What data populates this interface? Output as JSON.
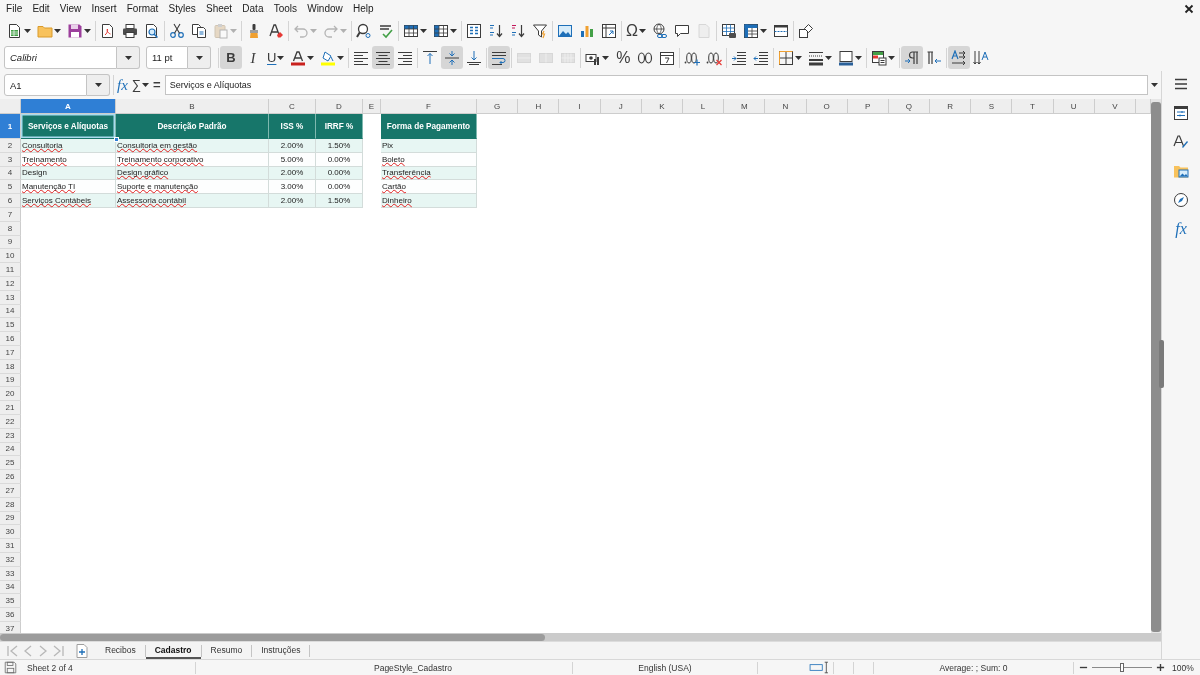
{
  "menu_bar": [
    "File",
    "Edit",
    "View",
    "Insert",
    "Format",
    "Styles",
    "Sheet",
    "Data",
    "Tools",
    "Window",
    "Help"
  ],
  "standard_toolbar": {
    "paste_disabled": true,
    "undo_disabled": true,
    "redo_disabled": true,
    "special_character": "Ω",
    "headers_footers_disabled": true
  },
  "formatting_toolbar": {
    "font_name": "Calibri",
    "font_size": "11 pt",
    "bold": {
      "label": "B",
      "on": true
    },
    "italic": {
      "label": "I",
      "on": false
    },
    "underline": {
      "label": "U",
      "on": false
    },
    "align_left": false,
    "align_center": true,
    "align_right": false,
    "align_top": false,
    "align_middle": true,
    "align_bottom": false,
    "wrap_text": true,
    "merge_disabled": true,
    "percent_format": "%",
    "left_to_right": true,
    "right_to_left": false,
    "text_horizontal": true,
    "text_vertical": false
  },
  "formula_bar": {
    "cell_reference": "A1",
    "function_wizard": "fx",
    "sum": "∑",
    "formula": "=",
    "content": "Serviços e Alíquotas"
  },
  "column_headers": [
    {
      "label": "A",
      "selected": true
    },
    {
      "label": "B",
      "selected": false
    },
    {
      "label": "C",
      "selected": false
    },
    {
      "label": "D",
      "selected": false
    },
    {
      "label": "E",
      "selected": false
    },
    {
      "label": "F",
      "selected": false
    },
    {
      "label": "G",
      "selected": false
    },
    {
      "label": "H",
      "selected": false
    },
    {
      "label": "I",
      "selected": false
    },
    {
      "label": "J",
      "selected": false
    },
    {
      "label": "K",
      "selected": false
    },
    {
      "label": "L",
      "selected": false
    },
    {
      "label": "M",
      "selected": false
    },
    {
      "label": "N",
      "selected": false
    },
    {
      "label": "O",
      "selected": false
    },
    {
      "label": "P",
      "selected": false
    },
    {
      "label": "Q",
      "selected": false
    },
    {
      "label": "R",
      "selected": false
    },
    {
      "label": "S",
      "selected": false
    },
    {
      "label": "T",
      "selected": false
    },
    {
      "label": "U",
      "selected": false
    },
    {
      "label": "V",
      "selected": false
    }
  ],
  "row_headers": [
    {
      "label": "1",
      "selected": true
    },
    {
      "label": "2",
      "selected": false
    },
    {
      "label": "3",
      "selected": false
    },
    {
      "label": "4",
      "selected": false
    },
    {
      "label": "5",
      "selected": false
    },
    {
      "label": "6",
      "selected": false
    },
    {
      "label": "7",
      "selected": false
    },
    {
      "label": "8",
      "selected": false
    },
    {
      "label": "9",
      "selected": false
    },
    {
      "label": "10",
      "selected": false
    },
    {
      "label": "11",
      "selected": false
    },
    {
      "label": "12",
      "selected": false
    },
    {
      "label": "13",
      "selected": false
    },
    {
      "label": "14",
      "selected": false
    },
    {
      "label": "15",
      "selected": false
    },
    {
      "label": "16",
      "selected": false
    },
    {
      "label": "17",
      "selected": false
    },
    {
      "label": "18",
      "selected": false
    },
    {
      "label": "19",
      "selected": false
    },
    {
      "label": "20",
      "selected": false
    },
    {
      "label": "21",
      "selected": false
    },
    {
      "label": "22",
      "selected": false
    },
    {
      "label": "23",
      "selected": false
    },
    {
      "label": "24",
      "selected": false
    },
    {
      "label": "25",
      "selected": false
    },
    {
      "label": "26",
      "selected": false
    },
    {
      "label": "27",
      "selected": false
    },
    {
      "label": "28",
      "selected": false
    },
    {
      "label": "29",
      "selected": false
    },
    {
      "label": "30",
      "selected": false
    },
    {
      "label": "31",
      "selected": false
    },
    {
      "label": "32",
      "selected": false
    },
    {
      "label": "33",
      "selected": false
    },
    {
      "label": "34",
      "selected": false
    },
    {
      "label": "35",
      "selected": false
    },
    {
      "label": "36",
      "selected": false
    },
    {
      "label": "37",
      "selected": false
    }
  ],
  "services_table": {
    "header": [
      {
        "text": "Serviços e Alíquotas",
        "selected": true
      },
      {
        "text": "Descrição Padrão",
        "selected": false
      },
      {
        "text": "ISS %",
        "selected": false
      },
      {
        "text": "IRRF %",
        "selected": false
      }
    ],
    "rows": [
      [
        {
          "text": "Consultoria",
          "selected": false,
          "spell_error": true
        },
        {
          "text": "Consultoria em gestão",
          "selected": false,
          "spell_error": true
        },
        {
          "text": "2.00%",
          "selected": false,
          "spell_error": false
        },
        {
          "text": "1.50%",
          "selected": false,
          "spell_error": false
        }
      ],
      [
        {
          "text": "Treinamento",
          "selected": false,
          "spell_error": true
        },
        {
          "text": "Treinamento corporativo",
          "selected": false,
          "spell_error": true
        },
        {
          "text": "5.00%",
          "selected": false,
          "spell_error": false
        },
        {
          "text": "0.00%",
          "selected": false,
          "spell_error": false
        }
      ],
      [
        {
          "text": "Design",
          "selected": false,
          "spell_error": false
        },
        {
          "text": "Design gráfico",
          "selected": false,
          "spell_error": true
        },
        {
          "text": "2.00%",
          "selected": false,
          "spell_error": false
        },
        {
          "text": "0.00%",
          "selected": false,
          "spell_error": false
        }
      ],
      [
        {
          "text": "Manutenção TI",
          "selected": false,
          "spell_error": true
        },
        {
          "text": "Suporte e manutenção",
          "selected": false,
          "spell_error": true
        },
        {
          "text": "3.00%",
          "selected": false,
          "spell_error": false
        },
        {
          "text": "0.00%",
          "selected": false,
          "spell_error": false
        }
      ],
      [
        {
          "text": "Serviços Contábeis",
          "selected": false,
          "spell_error": true
        },
        {
          "text": "Assessoria contábil",
          "selected": false,
          "spell_error": true
        },
        {
          "text": "2.00%",
          "selected": false,
          "spell_error": false
        },
        {
          "text": "1.50%",
          "selected": false,
          "spell_error": false
        }
      ]
    ]
  },
  "payment_table": {
    "header": {
      "text": "Forma de Pagamento",
      "selected": false
    },
    "rows": [
      {
        "text": "Pix",
        "selected": false,
        "spell_error": false
      },
      {
        "text": "Boleto",
        "selected": false,
        "spell_error": true
      },
      {
        "text": "Transferência",
        "selected": false,
        "spell_error": true
      },
      {
        "text": "Cartão",
        "selected": false,
        "spell_error": true
      },
      {
        "text": "Dinheiro",
        "selected": false,
        "spell_error": true
      }
    ]
  },
  "sheet_navigation": {
    "disabled": true
  },
  "sheet_tabs": [
    {
      "label": "Recibos",
      "selected": false
    },
    {
      "label": "Cadastro",
      "selected": true
    },
    {
      "label": "Resumo",
      "selected": false
    },
    {
      "label": "Instruções",
      "selected": false
    }
  ],
  "sidebar": {
    "functions_tab": "fx"
  },
  "status_bar": {
    "sheet": "Sheet 2 of 4",
    "page_style": "PageStyle_Cadastro",
    "language": "English (USA)",
    "summary": "Average: ; Sum: 0",
    "zoom_slider": {
      "level": 0.5
    },
    "zoom": "100%"
  }
}
